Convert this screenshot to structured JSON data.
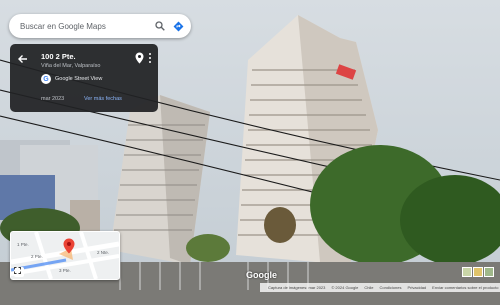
{
  "search": {
    "placeholder": "Buscar en Google Maps"
  },
  "info_card": {
    "address": "100 2 Pte.",
    "locality": "Viña del Mar, Valparaíso",
    "source": "Google Street View",
    "date": "mar 2023",
    "more_dates": "Ver más fechas"
  },
  "minimap": {
    "streets": [
      "1 Pte.",
      "2 Pte.",
      "3 Pte.",
      "2 Nte."
    ]
  },
  "branding": {
    "logo": "Google"
  },
  "footer": {
    "capture": "Captura de imágenes: mar 2023",
    "copyright": "© 2024 Google",
    "country": "Chile",
    "terms": "Condiciones",
    "privacy": "Privacidad",
    "report": "Enviar comentarios sobre el producto"
  },
  "colors": {
    "accent": "#8ab4f8",
    "pin": "#ea4335",
    "card_bg": "#202124"
  }
}
